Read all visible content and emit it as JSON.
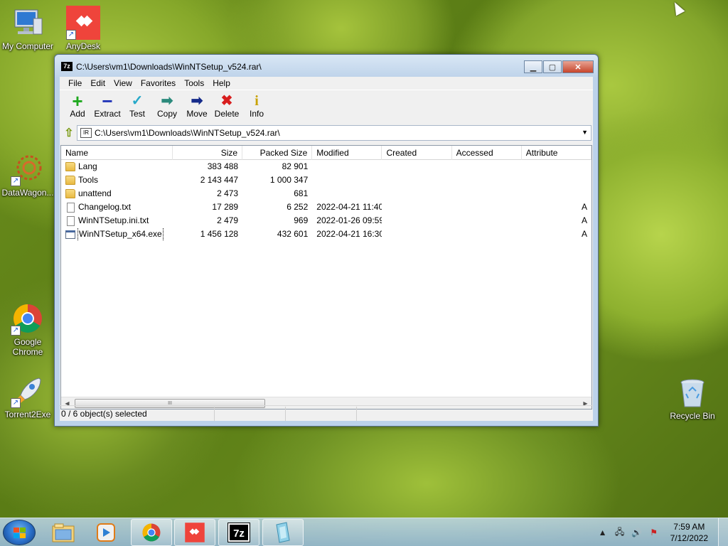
{
  "desktop": {
    "icons": [
      {
        "label": "My Computer",
        "icon": "computer-icon"
      },
      {
        "label": "AnyDesk",
        "icon": "anydesk-icon"
      },
      {
        "label": "DataWagon...",
        "icon": "datawagon-icon"
      },
      {
        "label": "Google Chrome",
        "icon": "chrome-icon"
      },
      {
        "label": "Torrent2Exe",
        "icon": "rocket-icon"
      },
      {
        "label": "Recycle Bin",
        "icon": "recycle-bin-icon"
      }
    ]
  },
  "window": {
    "app_icon_text": "7z",
    "title": "C:\\Users\\vm1\\Downloads\\WinNTSetup_v524.rar\\",
    "buttons": {
      "minimize": "▁",
      "maximize": "▢",
      "close": "✕"
    }
  },
  "menu": [
    "File",
    "Edit",
    "View",
    "Favorites",
    "Tools",
    "Help"
  ],
  "toolbar": [
    {
      "label": "Add",
      "icon": "plus-icon",
      "glyph": "+",
      "color": "#1ea81e"
    },
    {
      "label": "Extract",
      "icon": "minus-icon",
      "glyph": "−",
      "color": "#1f33b8"
    },
    {
      "label": "Test",
      "icon": "check-icon",
      "glyph": "✓",
      "color": "#27a9c9"
    },
    {
      "label": "Copy",
      "icon": "copy-arrow-icon",
      "glyph": "➡",
      "color": "#2b8a7c"
    },
    {
      "label": "Move",
      "icon": "move-arrow-icon",
      "glyph": "➡",
      "color": "#142a8a"
    },
    {
      "label": "Delete",
      "icon": "delete-x-icon",
      "glyph": "✖",
      "color": "#d81e1e"
    },
    {
      "label": "Info",
      "icon": "info-icon",
      "glyph": "i",
      "color": "#c8a200"
    }
  ],
  "address": {
    "icon_text": "IR",
    "path": "C:\\Users\\vm1\\Downloads\\WinNTSetup_v524.rar\\"
  },
  "columns": {
    "name": "Name",
    "size": "Size",
    "packed": "Packed Size",
    "modified": "Modified",
    "created": "Created",
    "accessed": "Accessed",
    "attributes": "Attribute"
  },
  "files": [
    {
      "name": "Lang",
      "type": "folder",
      "size": "383 488",
      "packed": "82 901",
      "modified": "",
      "attr": ""
    },
    {
      "name": "Tools",
      "type": "folder",
      "size": "2 143 447",
      "packed": "1 000 347",
      "modified": "",
      "attr": ""
    },
    {
      "name": "unattend",
      "type": "folder",
      "size": "2 473",
      "packed": "681",
      "modified": "",
      "attr": ""
    },
    {
      "name": "Changelog.txt",
      "type": "txt",
      "size": "17 289",
      "packed": "6 252",
      "modified": "2022-04-21 11:40",
      "attr": "A"
    },
    {
      "name": "WinNTSetup.ini.txt",
      "type": "txt",
      "size": "2 479",
      "packed": "969",
      "modified": "2022-01-26 09:59",
      "attr": "A"
    },
    {
      "name": "WinNTSetup_x64.exe",
      "type": "exe",
      "size": "1 456 128",
      "packed": "432 601",
      "modified": "2022-04-21 16:30",
      "attr": "A"
    }
  ],
  "status": {
    "selection": "0 / 6 object(s) selected"
  },
  "scrollbar_thumb_grip": "III",
  "taskbar": {
    "items": [
      "explorer-icon",
      "media-player-icon",
      "chrome-icon",
      "anydesk-icon",
      "7zip-icon",
      "app-icon"
    ],
    "sevenzip_text": "7z",
    "clock_time": "7:59 AM",
    "clock_date": "7/12/2022"
  }
}
